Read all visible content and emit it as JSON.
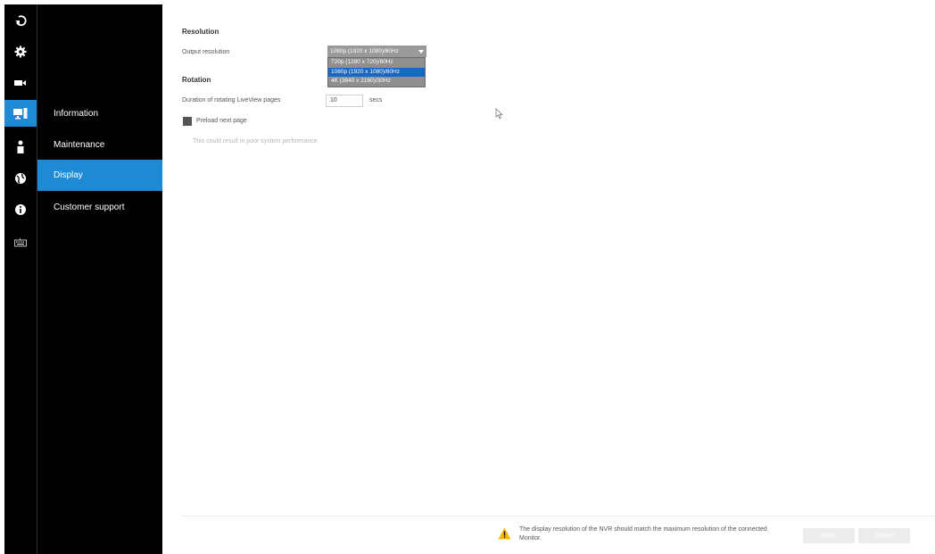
{
  "nav": {
    "rail_icons": [
      "logout-icon",
      "gear-icon",
      "camera-icon",
      "display-icon",
      "user-icon",
      "network-icon",
      "info-icon",
      "keyboard-icon"
    ],
    "rail_active_index": 3,
    "items": [
      {
        "label": "Information"
      },
      {
        "label": "Maintenance"
      },
      {
        "label": "Display"
      },
      {
        "label": "Customer support"
      }
    ],
    "active_item": "Display"
  },
  "resolution": {
    "title": "Resolution",
    "label": "Output resolution",
    "selected": "1080p (1920 x 1080)/60Hz",
    "options": [
      "720p (1280 x 720)/60Hz",
      "1080p (1920 x 1080)/60Hz",
      "4K (3840 x 2160)/30Hz"
    ]
  },
  "rotation": {
    "title": "Rotation",
    "duration_label": "Duration of rotating LiveView pages",
    "duration_value": "10",
    "unit": "secs",
    "preload_label": "Preload next page",
    "preload_hint": "This could result in poor system performance."
  },
  "footer": {
    "warning": "The display resolution of the NVR should match the maximum resolution of the connected Monitor.",
    "apply_label": "Apply",
    "cancel_label": "Cancel"
  },
  "colors": {
    "accent": "#1e8ad6",
    "sidebar_bg": "#000000",
    "selected_option": "#1468c8",
    "warning": "#f5b800"
  }
}
